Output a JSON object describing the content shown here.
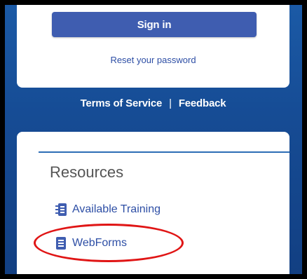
{
  "login": {
    "sign_in_label": "Sign in",
    "reset_password_label": "Reset your password"
  },
  "footer": {
    "terms_label": "Terms of Service",
    "separator": "|",
    "feedback_label": "Feedback"
  },
  "resources": {
    "title": "Resources",
    "items": [
      {
        "label": "Available Training",
        "icon": "training-list-icon"
      },
      {
        "label": "WebForms",
        "icon": "document-icon"
      }
    ]
  },
  "colors": {
    "brand_blue": "#1b5aa6",
    "button_blue": "#3f5db0",
    "link_blue": "#2d4ea5",
    "highlight_red": "#e01515"
  }
}
